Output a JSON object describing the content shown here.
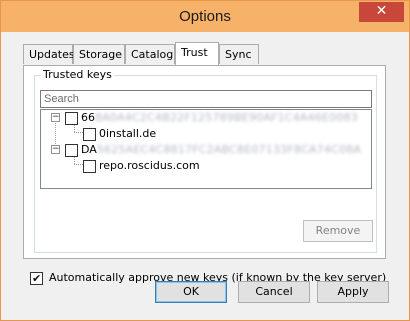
{
  "window": {
    "title": "Options",
    "close_glyph": "✕"
  },
  "tabs": [
    {
      "label": "Updates"
    },
    {
      "label": "Storage"
    },
    {
      "label": "Catalog"
    },
    {
      "label": "Trust",
      "active": true
    },
    {
      "label": "Sync"
    }
  ],
  "trusted_keys": {
    "group_label": "Trusted keys",
    "search_placeholder": "Search",
    "tree": [
      {
        "key_prefix": "66",
        "expanded": true,
        "checked": false,
        "children": [
          {
            "label": "0install.de",
            "checked": false
          }
        ]
      },
      {
        "key_prefix": "DA",
        "expanded": true,
        "checked": false,
        "children": [
          {
            "label": "repo.roscidus.com",
            "checked": false
          }
        ]
      }
    ],
    "remove_label": "Remove"
  },
  "auto_approve": {
    "label": "Automatically approve new keys (if known by the key server)",
    "checked": true,
    "check_glyph": "✔"
  },
  "buttons": {
    "ok": "OK",
    "cancel": "Cancel",
    "apply": "Apply"
  },
  "icons": {
    "expander_glyph": "−"
  },
  "colors": {
    "titlebar": "#f7b26a",
    "close": "#c9473a",
    "default_button_border": "#3c7fb1"
  }
}
